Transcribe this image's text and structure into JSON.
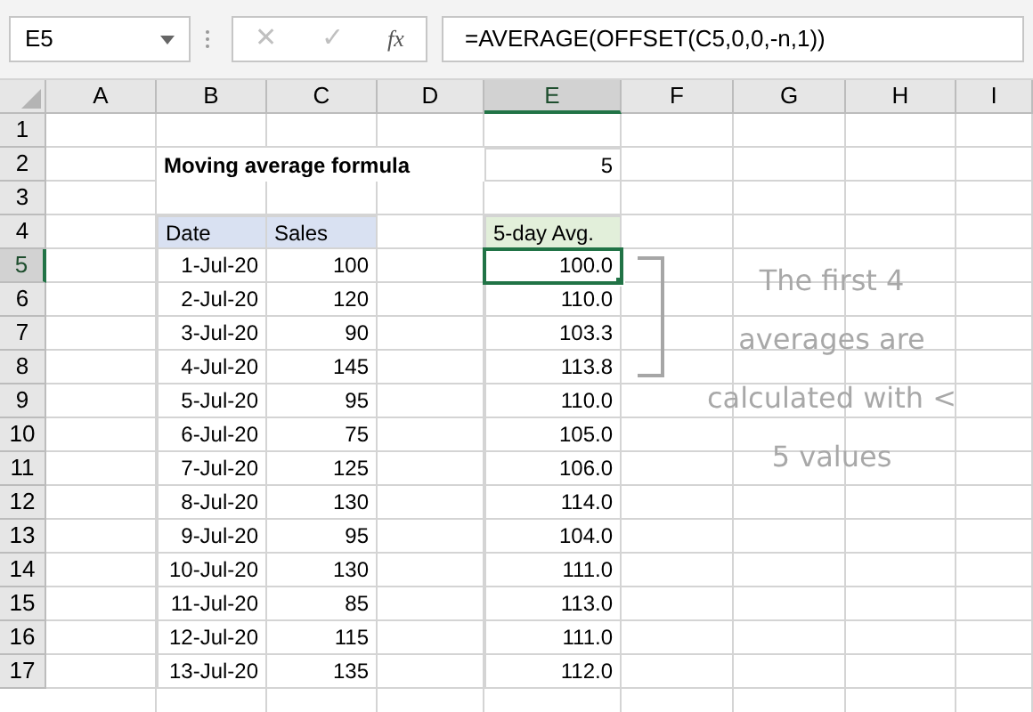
{
  "formula_bar": {
    "name_box": "E5",
    "cancel": "✕",
    "enter": "✓",
    "fx": "fx",
    "formula": "=AVERAGE(OFFSET(C5,0,0,-n,1))"
  },
  "columns": [
    {
      "label": "A",
      "selected": false
    },
    {
      "label": "B",
      "selected": false
    },
    {
      "label": "C",
      "selected": false
    },
    {
      "label": "D",
      "selected": false
    },
    {
      "label": "E",
      "selected": true
    },
    {
      "label": "F",
      "selected": false
    },
    {
      "label": "G",
      "selected": false
    },
    {
      "label": "H",
      "selected": false
    },
    {
      "label": "I",
      "selected": false
    }
  ],
  "row_headers": [
    {
      "label": "1",
      "selected": false
    },
    {
      "label": "2",
      "selected": false
    },
    {
      "label": "3",
      "selected": false
    },
    {
      "label": "4",
      "selected": false
    },
    {
      "label": "5",
      "selected": true
    },
    {
      "label": "6",
      "selected": false
    },
    {
      "label": "7",
      "selected": false
    },
    {
      "label": "8",
      "selected": false
    },
    {
      "label": "9",
      "selected": false
    },
    {
      "label": "10",
      "selected": false
    },
    {
      "label": "11",
      "selected": false
    },
    {
      "label": "12",
      "selected": false
    },
    {
      "label": "13",
      "selected": false
    },
    {
      "label": "14",
      "selected": false
    },
    {
      "label": "15",
      "selected": false
    },
    {
      "label": "16",
      "selected": false
    },
    {
      "label": "17",
      "selected": false
    }
  ],
  "title": "Moving average formula",
  "n_value": "5",
  "table": {
    "columns": [
      "Date",
      "Sales"
    ],
    "avg_column": "5-day Avg.",
    "rows": [
      {
        "date": "1-Jul-20",
        "sales": "100",
        "avg": "100.0",
        "selected": true
      },
      {
        "date": "2-Jul-20",
        "sales": "120",
        "avg": "110.0",
        "selected": false
      },
      {
        "date": "3-Jul-20",
        "sales": "90",
        "avg": "103.3",
        "selected": false
      },
      {
        "date": "4-Jul-20",
        "sales": "145",
        "avg": "113.8",
        "selected": false
      },
      {
        "date": "5-Jul-20",
        "sales": "95",
        "avg": "110.0",
        "selected": false
      },
      {
        "date": "6-Jul-20",
        "sales": "75",
        "avg": "105.0",
        "selected": false
      },
      {
        "date": "7-Jul-20",
        "sales": "125",
        "avg": "106.0",
        "selected": false
      },
      {
        "date": "8-Jul-20",
        "sales": "130",
        "avg": "114.0",
        "selected": false
      },
      {
        "date": "9-Jul-20",
        "sales": "95",
        "avg": "104.0",
        "selected": false
      },
      {
        "date": "10-Jul-20",
        "sales": "130",
        "avg": "111.0",
        "selected": false
      },
      {
        "date": "11-Jul-20",
        "sales": "85",
        "avg": "113.0",
        "selected": false
      },
      {
        "date": "12-Jul-20",
        "sales": "115",
        "avg": "111.0",
        "selected": false
      },
      {
        "date": "13-Jul-20",
        "sales": "135",
        "avg": "112.0",
        "selected": false
      }
    ]
  },
  "note": "The first 4 averages are calculated with < 5 values"
}
